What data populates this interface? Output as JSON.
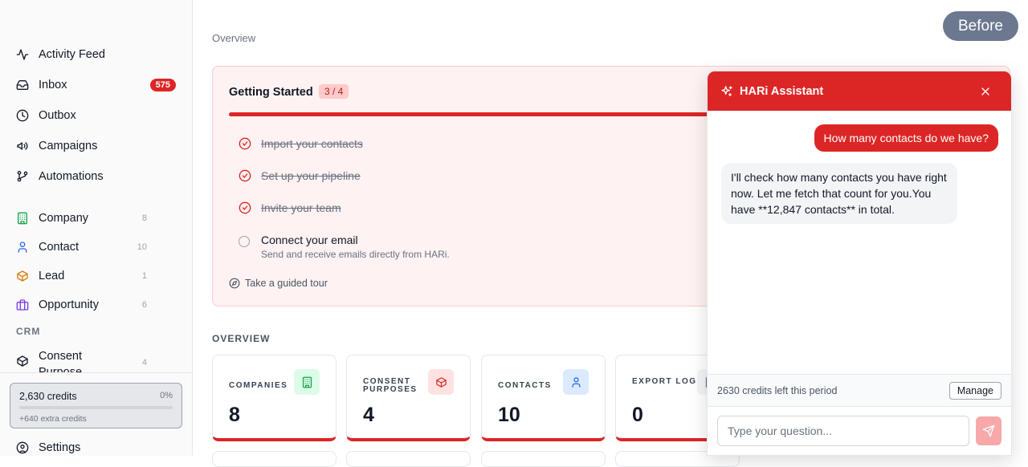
{
  "sidebar": {
    "items": [
      {
        "label": "Activity Feed",
        "icon": "activity-icon"
      },
      {
        "label": "Inbox",
        "icon": "inbox-icon",
        "badge": "575"
      },
      {
        "label": "Outbox",
        "icon": "clock-icon"
      },
      {
        "label": "Campaigns",
        "icon": "megaphone-icon"
      },
      {
        "label": "Automations",
        "icon": "workflow-icon"
      },
      {
        "label": "Company",
        "icon": "building-icon",
        "count": "8"
      },
      {
        "label": "Contact",
        "icon": "user-icon",
        "count": "10"
      },
      {
        "label": "Lead",
        "icon": "box-icon",
        "count": "1"
      },
      {
        "label": "Opportunity",
        "icon": "briefcase-icon",
        "count": "6"
      },
      {
        "label": "Consent Purpose",
        "icon": "package-icon",
        "count": "4"
      },
      {
        "label": "Settings",
        "icon": "user-circle-icon"
      }
    ],
    "section_label": "CRM",
    "credits": {
      "amount": "2,630 credits",
      "percent": "0%",
      "extra": "+640 extra credits"
    }
  },
  "main": {
    "top_label": "Overview",
    "before_label": "Before",
    "getting_started": {
      "title": "Getting Started",
      "progress": "3 / 4",
      "tasks": [
        {
          "label": "Import your contacts",
          "done": true
        },
        {
          "label": "Set up your pipeline",
          "done": true
        },
        {
          "label": "Invite your team",
          "done": true
        }
      ],
      "open_task": {
        "label": "Connect your email",
        "description": "Send and receive emails directly from HARi."
      },
      "tour_label": "Take a guided tour"
    },
    "overview_label": "OVERVIEW",
    "stats": [
      {
        "label": "COMPANIES",
        "value": "8",
        "icon": "building-icon"
      },
      {
        "label": "CONSENT PURPOSES",
        "value": "4",
        "icon": "package-icon"
      },
      {
        "label": "CONTACTS",
        "value": "10",
        "icon": "user-icon"
      },
      {
        "label": "EXPORT LOGS",
        "value": "0",
        "icon": "file-icon"
      }
    ]
  },
  "assistant": {
    "title": "HARi Assistant",
    "messages": [
      {
        "role": "user",
        "text": "How many contacts do we have?"
      },
      {
        "role": "assistant",
        "text": "I'll check how many contacts you have right now. Let me fetch that count for you.You have **12,847 contacts** in total."
      }
    ],
    "credits_text": "2630 credits left this period",
    "manage_label": "Manage",
    "input_placeholder": "Type your question..."
  },
  "colors": {
    "accent": "#dc2626",
    "accent_light": "#fef2f2"
  }
}
